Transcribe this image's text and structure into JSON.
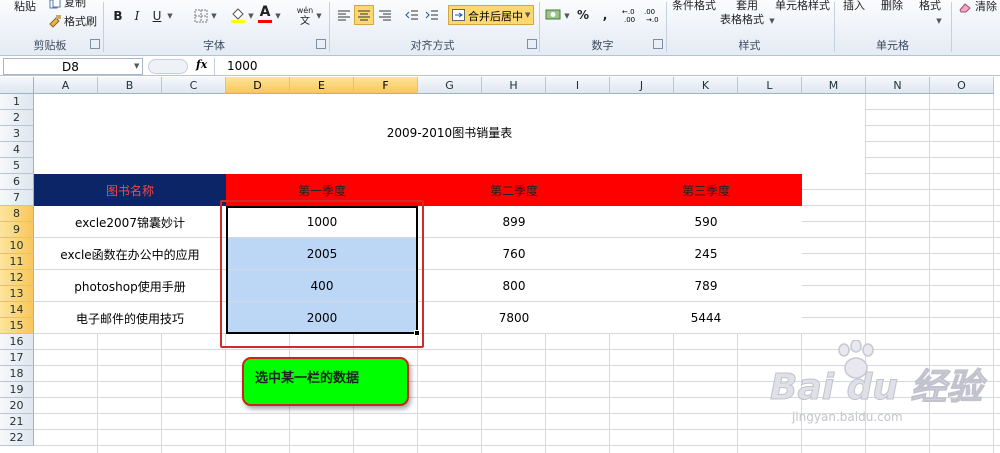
{
  "ribbon": {
    "clipboard": {
      "paste": "粘贴",
      "copy": "复制",
      "format_painter": "格式刷",
      "label": "剪贴板"
    },
    "font": {
      "label": "字体",
      "bold": "B",
      "italic": "I",
      "underline": "U",
      "color_a": "A",
      "wen": "wén"
    },
    "alignment": {
      "label": "对齐方式",
      "merge_center": "合并后居中"
    },
    "number": {
      "label": "数字",
      "percent": "%",
      "comma": ","
    },
    "styles": {
      "label": "样式",
      "conditional": "条件格式",
      "table_line1": "套用",
      "table_line2": "表格格式",
      "cell_styles": "单元格样式"
    },
    "cells": {
      "label": "单元格",
      "insert": "插入",
      "delete": "删除",
      "format": "格式"
    },
    "editing": {
      "clear": "清除"
    }
  },
  "formula_bar": {
    "name_box": "D8",
    "fx": "fx",
    "value": "1000"
  },
  "columns": [
    "A",
    "B",
    "C",
    "D",
    "E",
    "F",
    "G",
    "H",
    "I",
    "J",
    "K",
    "L",
    "M",
    "N",
    "O"
  ],
  "rows": [
    "1",
    "2",
    "3",
    "4",
    "5",
    "6",
    "7",
    "8",
    "9",
    "10",
    "11",
    "12",
    "13",
    "14",
    "15",
    "16",
    "17",
    "18",
    "19",
    "20",
    "21",
    "22"
  ],
  "sheet": {
    "title": "2009-2010图书销量表",
    "headers": [
      "图书名称",
      "第一季度",
      "第二季度",
      "第三季度"
    ],
    "data": [
      {
        "name": "excle2007锦囊妙计",
        "q1": "1000",
        "q2": "899",
        "q3": "590"
      },
      {
        "name": "excle函数在办公中的应用",
        "q1": "2005",
        "q2": "760",
        "q3": "245"
      },
      {
        "name": "photoshop使用手册",
        "q1": "400",
        "q2": "800",
        "q3": "789"
      },
      {
        "name": "电子邮件的使用技巧",
        "q1": "2000",
        "q2": "7800",
        "q3": "5444"
      }
    ]
  },
  "annotation": {
    "text": "选中某一栏的数据"
  },
  "watermark": {
    "brand": "Bai du 经验",
    "url": "jingyan.baidu.com"
  },
  "colors": {
    "header_navy": "#0b2566",
    "header_red": "#ff0000",
    "selection": "#bcd7f5",
    "annotation_green": "#00ff00",
    "annotation_border": "#cc2222"
  }
}
